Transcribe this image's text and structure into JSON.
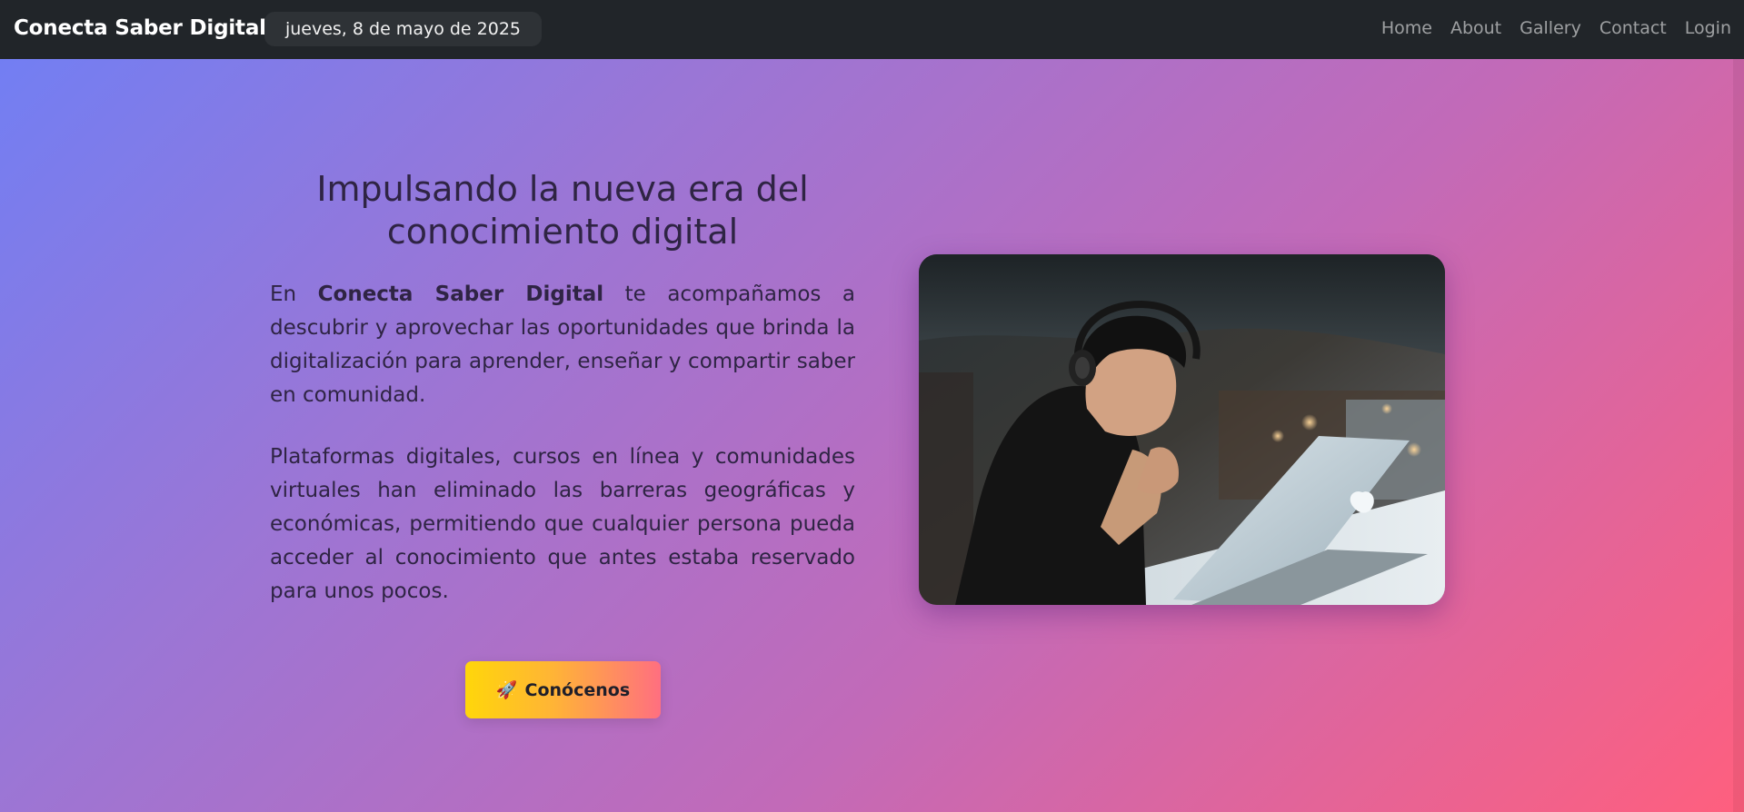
{
  "navbar": {
    "brand": "Conecta Saber Digital",
    "date": "jueves, 8 de mayo de 2025",
    "links": [
      "Home",
      "About",
      "Gallery",
      "Contact",
      "Login"
    ]
  },
  "hero": {
    "title": "Impulsando la nueva era del conocimiento digital",
    "paragraph1": {
      "before": "En ",
      "highlight": "Conecta Saber Digital",
      "after": " te acompañamos a descubrir y aprovechar las oportunidades que brinda la digitalización para aprender, enseñar y compartir saber en comunidad."
    },
    "paragraph2": "Plataformas digitales, cursos en línea y comunidades virtuales han eliminado las barreras geográficas y económicas, permitiendo que cualquier persona pueda acceder al conocimiento que antes estaba reservado para unos pocos.",
    "cta": {
      "icon": "🚀",
      "label": "Conócenos"
    },
    "image": {
      "icon_name": "photo-man-laptop-headphones"
    }
  },
  "colors": {
    "navbar_bg": "#212529",
    "gradient_start": "#6f7ff5",
    "gradient_end": "#ff5f7e",
    "cta_start": "#ffd60a",
    "cta_end": "#ff6f80",
    "text": "#2f2444"
  }
}
